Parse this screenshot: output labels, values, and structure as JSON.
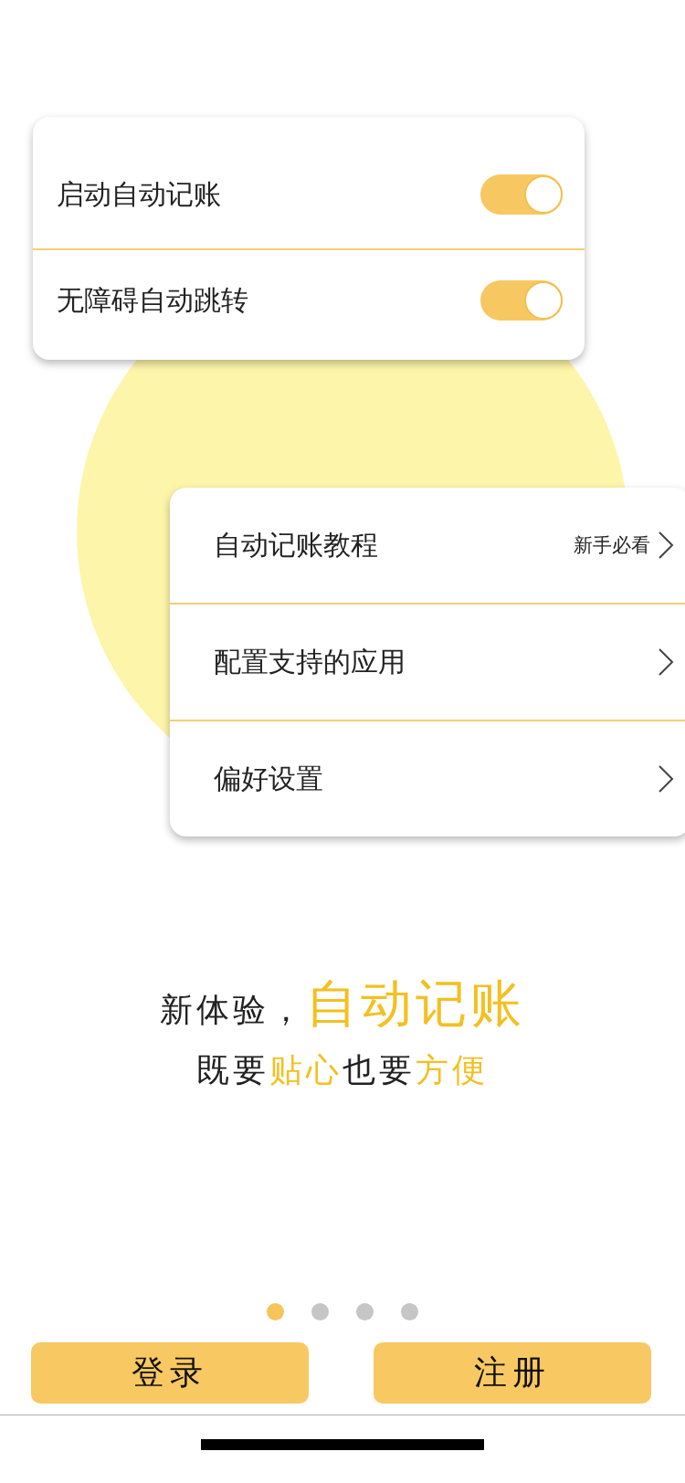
{
  "switch_card": {
    "items": [
      {
        "label": "启动自动记账",
        "on": true
      },
      {
        "label": "无障碍自动跳转",
        "on": true
      }
    ]
  },
  "menu_card": {
    "items": [
      {
        "label": "自动记账教程",
        "hint": "新手必看"
      },
      {
        "label": "配置支持的应用"
      },
      {
        "label": "偏好设置"
      }
    ]
  },
  "headline": [
    {
      "segments": [
        {
          "text": "新体验，",
          "highlight": false
        },
        {
          "text": "自动记账",
          "highlight": true
        }
      ]
    },
    {
      "segments": [
        {
          "text": "既要",
          "highlight": false
        },
        {
          "text": "贴心",
          "highlight": true
        },
        {
          "text": "也要",
          "highlight": false
        },
        {
          "text": "方便",
          "highlight": true
        }
      ]
    }
  ],
  "pager": [
    {
      "selected": true
    },
    {
      "selected": false
    },
    {
      "selected": false
    },
    {
      "selected": false
    }
  ],
  "buttons": [
    {
      "label": "登录"
    },
    {
      "label": "注册"
    }
  ]
}
